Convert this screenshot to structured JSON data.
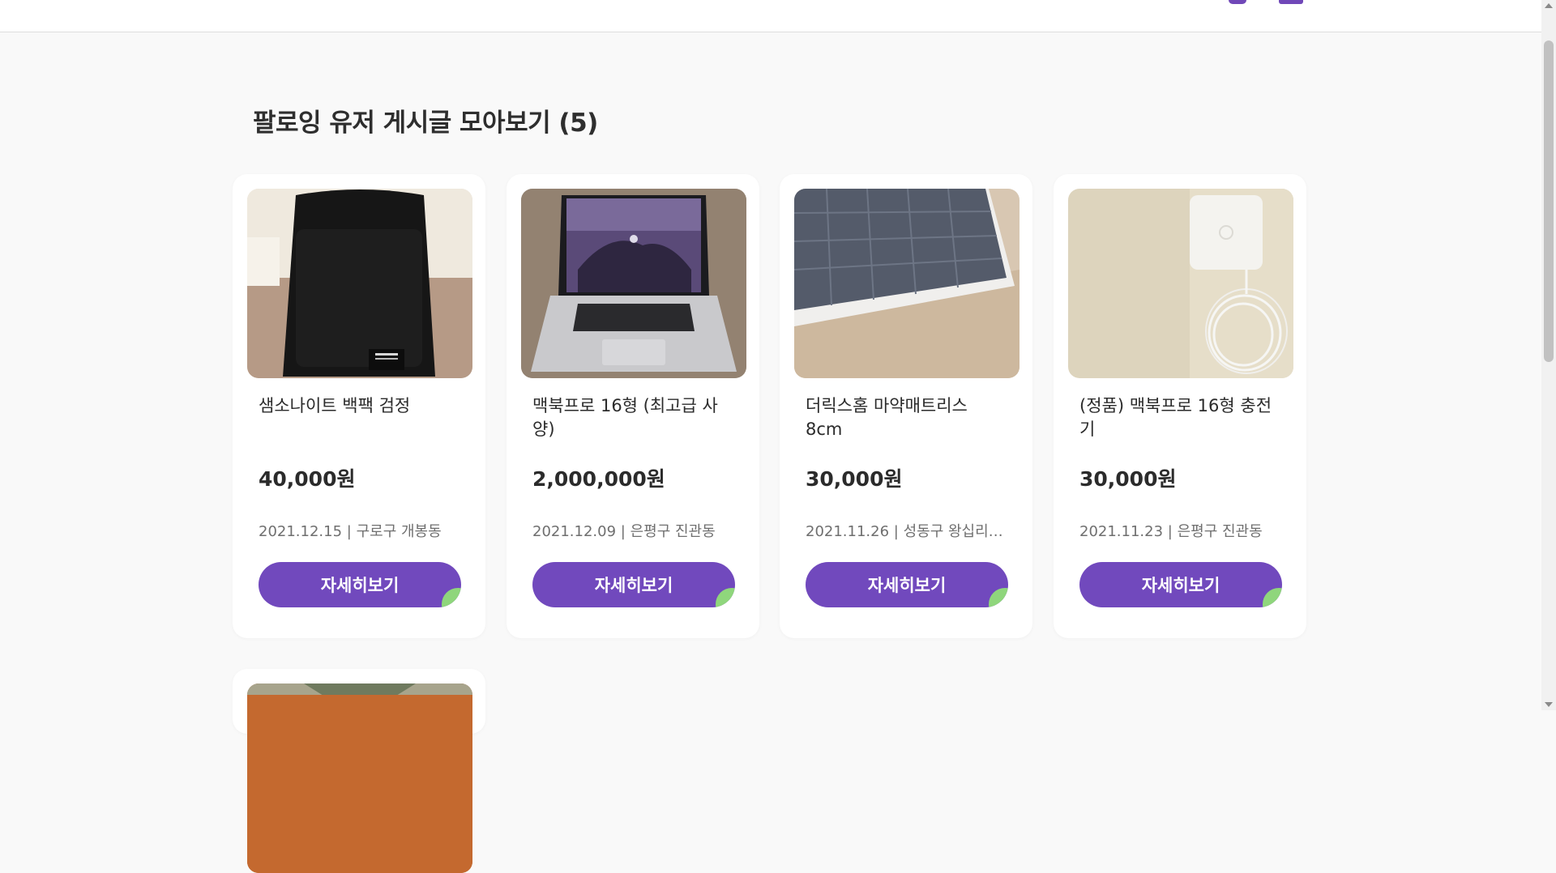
{
  "page": {
    "title": "팔로잉 유저 게시글 모아보기 (5)"
  },
  "colors": {
    "accent": "#7149bd",
    "accent_leaf": "#8fd67c",
    "background": "#f9f9f9"
  },
  "posts": [
    {
      "title": "샘소나이트 백팩 검정",
      "price": "40,000원",
      "meta": "2021.12.15 | 구로구 개봉동",
      "button": "자세히보기",
      "image": "black-backpack-photo"
    },
    {
      "title": "맥북프로 16형 (최고급 사양)",
      "price": "2,000,000원",
      "meta": "2021.12.09 | 은평구 진관동",
      "button": "자세히보기",
      "image": "macbook-pro-photo"
    },
    {
      "title": "더릭스홈 마약매트리스 8cm",
      "price": "30,000원",
      "meta": "2021.11.26 | 성동구 왕십리…",
      "button": "자세히보기",
      "image": "mattress-photo"
    },
    {
      "title": "(정품) 맥북프로 16형 충전기",
      "price": "30,000원",
      "meta": "2021.11.23 | 은평구 진관동",
      "button": "자세히보기",
      "image": "macbook-charger-photo"
    },
    {
      "image": "orange-jacket-photo"
    }
  ]
}
